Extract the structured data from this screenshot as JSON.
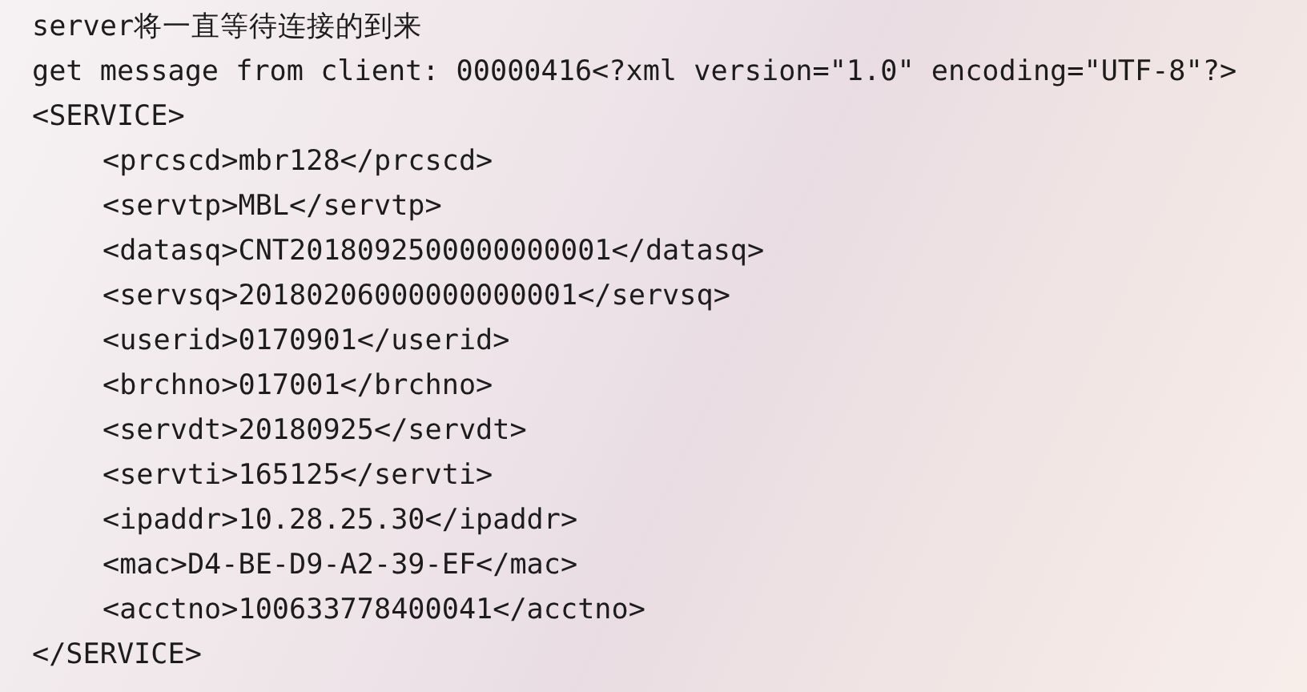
{
  "console": {
    "lines": [
      {
        "text": "server将一直等待连接的到来"
      },
      {
        "text": "get message from client: 00000416<?xml version=\"1.0\" encoding=\"UTF-8\"?>"
      },
      {
        "text": "<SERVICE>",
        "children": [
          {
            "text": "<prcscd>mbr128</prcscd>"
          },
          {
            "text": "<servtp>MBL</servtp>"
          },
          {
            "text": "<datasq>CNT2018092500000000001</datasq>"
          },
          {
            "text": "<servsq>20180206000000000001</servsq>"
          },
          {
            "text": "<userid>0170901</userid>"
          },
          {
            "text": "<brchno>017001</brchno>"
          },
          {
            "text": "<servdt>20180925</servdt>"
          },
          {
            "text": "<servti>165125</servti>"
          },
          {
            "text": "<ipaddr>10.28.25.30</ipaddr>"
          },
          {
            "text": "<mac>D4-BE-D9-A2-39-EF</mac>"
          },
          {
            "text": "<acctno>100633778400041</acctno>"
          }
        ]
      },
      {
        "text": "</SERVICE>"
      }
    ]
  }
}
